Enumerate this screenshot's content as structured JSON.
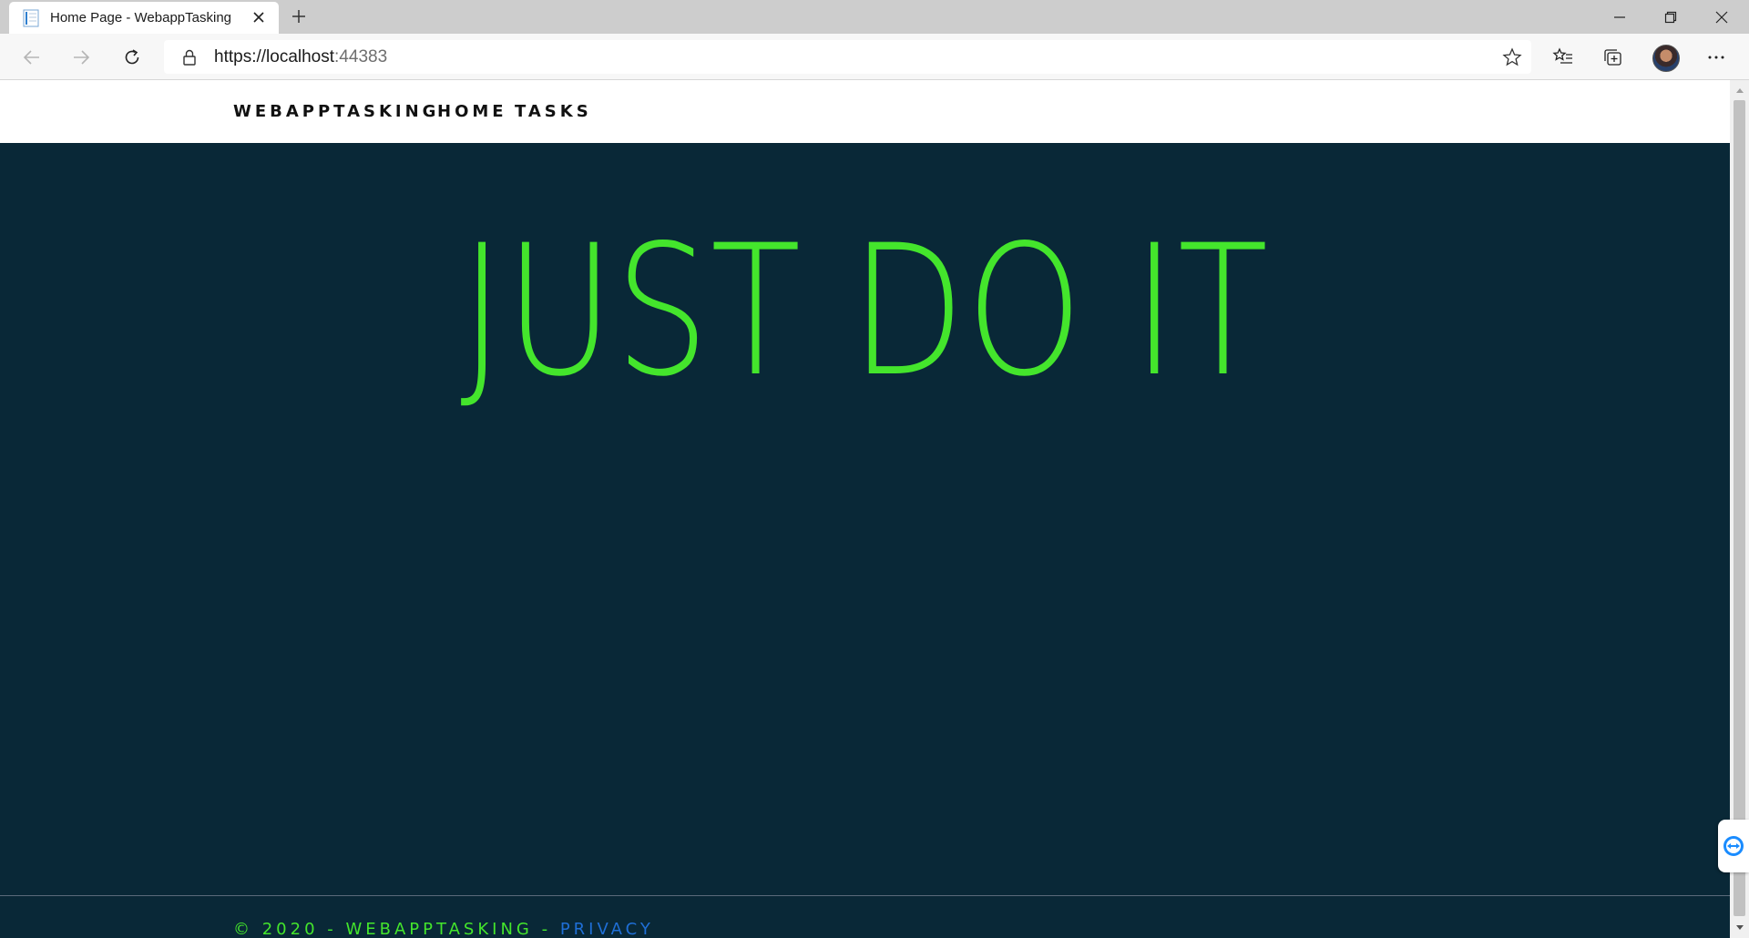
{
  "browser": {
    "tab_title": "Home Page - WebappTasking",
    "url_scheme_host": "https://localhost",
    "url_port": ":44383"
  },
  "site": {
    "brand": "WEBAPPTASKING",
    "nav": [
      {
        "label": "HOME"
      },
      {
        "label": "TASKS"
      }
    ],
    "hero_title": "JUST DO IT",
    "footer_text": "© 2020 - WEBAPPTASKING - ",
    "footer_link": "PRIVACY"
  },
  "colors": {
    "hero_bg": "#092837",
    "accent_green": "#44e52c",
    "link_blue": "#1f6fd6"
  }
}
